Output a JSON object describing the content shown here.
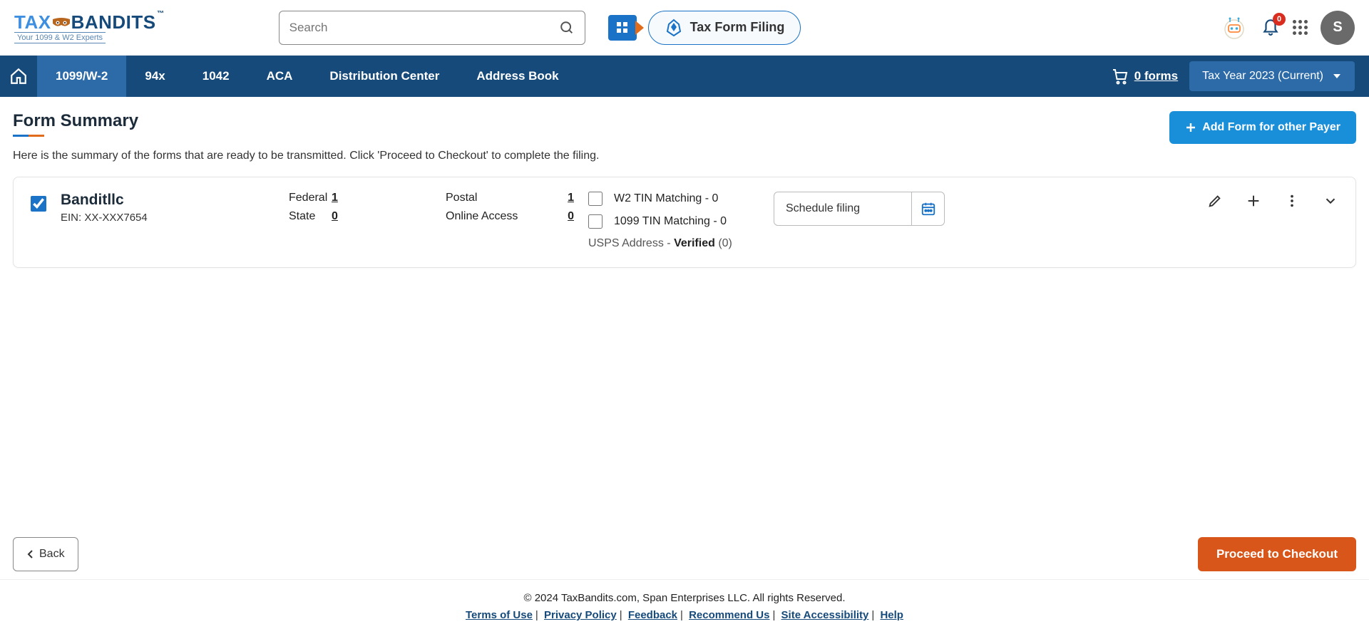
{
  "header": {
    "logo": {
      "text_tax": "TAX",
      "text_bandits": "BANDITS",
      "tm": "™",
      "subtitle": "Your 1099 & W2 Experts"
    },
    "search_placeholder": "Search",
    "tax_form_pill": "Tax Form Filing",
    "notifications_count": "0",
    "avatar_letter": "S"
  },
  "nav": {
    "items": [
      "1099/W-2",
      "94x",
      "1042",
      "ACA",
      "Distribution Center",
      "Address Book"
    ],
    "cart_text": "0 forms",
    "year_text": "Tax Year 2023 (Current)"
  },
  "page": {
    "title": "Form Summary",
    "description": "Here is the summary of the forms that are ready to be transmitted. Click 'Proceed to Checkout' to complete the filing.",
    "add_form_btn": "Add Form  for other Payer"
  },
  "card": {
    "payer_name": "Banditllc",
    "payer_ein": "EIN: XX-XXX7654",
    "federal_label": "Federal",
    "federal_value": "1",
    "state_label": "State",
    "state_value": "0",
    "postal_label": "Postal",
    "postal_value": "1",
    "online_label": "Online Access",
    "online_value": "0",
    "w2_tin_label": "W2 TIN Matching - 0",
    "tin_1099_label": "1099 TIN Matching - 0",
    "usps_prefix": "USPS Address -",
    "usps_verified": "Verified",
    "usps_count": "(0)",
    "schedule_label": "Schedule filing"
  },
  "footer": {
    "back_btn": "Back",
    "proceed_btn": "Proceed to Checkout"
  },
  "legal": {
    "copyright": "© 2024 TaxBandits.com, Span Enterprises LLC. All rights Reserved.",
    "links": [
      "Terms of Use",
      "Privacy Policy",
      "Feedback",
      "Recommend Us",
      "Site Accessibility",
      "Help"
    ]
  }
}
